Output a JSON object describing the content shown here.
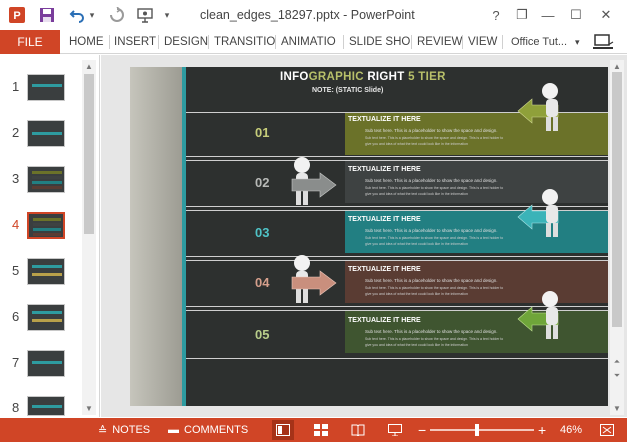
{
  "app": {
    "title": "clean_edges_18297.pptx - PowerPoint",
    "help": "?",
    "restore": "❐",
    "minimize": "—",
    "maximize": "☐",
    "close": "✕"
  },
  "quick_access": {
    "undo_arrow": "▾"
  },
  "ribbon": {
    "file": "FILE",
    "tabs": [
      "HOME",
      "INSERT",
      "DESIGN",
      "TRANSITIO",
      "ANIMATIO",
      "SLIDE SHO",
      "REVIEW",
      "VIEW"
    ],
    "account": "Office Tut...",
    "account_arrow": "▾"
  },
  "thumbnails": {
    "numbers": [
      "1",
      "2",
      "3",
      "4",
      "5",
      "6",
      "7",
      "8"
    ],
    "active_index": 4
  },
  "slide": {
    "title_part1": "INFO",
    "title_part2": "GRAPHIC",
    "title_part3": "RIGHT",
    "title_part4": "5 TIER",
    "note": "NOTE: (STATIC Slide)",
    "rows": [
      {
        "num": "01",
        "heading": "TEXTUALIZE IT HERE",
        "sub": "Sub text here. This is a placeholder to show the space and design.",
        "detail1": "Sub text here. This is a placeholder to show the space and design. This is a text holder to",
        "detail2": "give you and idea of what the text could look like in the information",
        "color": "#6b7229",
        "num_color": "#c6cd7a"
      },
      {
        "num": "02",
        "heading": "TEXTUALIZE IT HERE",
        "sub": "Sub text here. This is a placeholder to show the space and design.",
        "detail1": "Sub text here. This is a placeholder to show the space and design. This is a text holder to",
        "detail2": "give you and idea of what the text could look like in the information",
        "color": "#3e4242",
        "num_color": "#b7b9b7"
      },
      {
        "num": "03",
        "heading": "TEXTUALIZE IT HERE",
        "sub": "Sub text here. This is a placeholder to show the space and design.",
        "detail1": "Sub text here. This is a placeholder to show the space and design. This is a text holder to",
        "detail2": "give you and idea of what the text could look like in the information",
        "color": "#227f82",
        "num_color": "#4fc3c7"
      },
      {
        "num": "04",
        "heading": "TEXTUALIZE IT HERE",
        "sub": "Sub text here. This is a placeholder to show the space and design.",
        "detail1": "Sub text here. This is a placeholder to show the space and design. This is a text holder to",
        "detail2": "give you and idea of what the text could look like in the information",
        "color": "#5a3c33",
        "num_color": "#d59f8c"
      },
      {
        "num": "05",
        "heading": "TEXTUALIZE IT HERE",
        "sub": "Sub text here. This is a placeholder to show the space and design.",
        "detail1": "Sub text here. This is a placeholder to show the space and design. This is a text holder to",
        "detail2": "give you and idea of what the text could look like in the information",
        "color": "#3f5530",
        "num_color": "#b8cd8b"
      }
    ]
  },
  "statusbar": {
    "notes": "NOTES",
    "comments": "COMMENTS",
    "zoom_minus": "−",
    "zoom_plus": "+",
    "zoom": "46%",
    "zoom_level": 0.46
  },
  "colors": {
    "accent": "#d04526",
    "slide_bg": "#2d302f",
    "teal_bar": "#2e9ba0"
  }
}
